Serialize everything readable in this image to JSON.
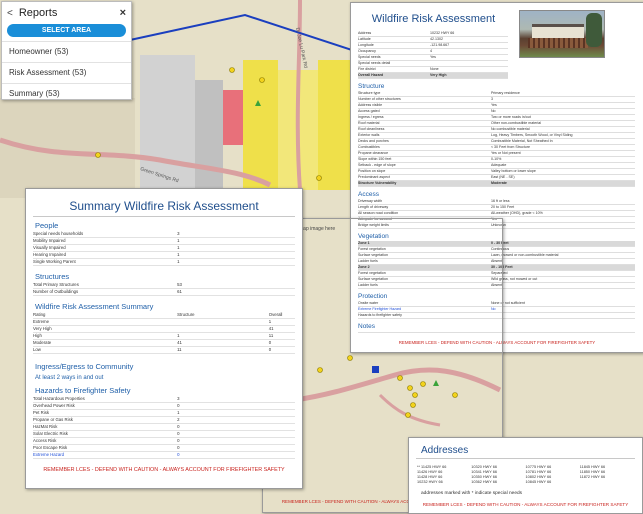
{
  "map": {
    "road_label": "Dr Joe Lu Park Rd",
    "street_label": "Green Springs Rd",
    "missing_image_text": "map image here"
  },
  "reports_panel": {
    "title": "Reports",
    "close_glyph": "×",
    "back_glyph": "<",
    "select_area_label": "SELECT AREA",
    "items": [
      "Homeowner (53)",
      "Risk Assessment (53)",
      "Summary (53)"
    ]
  },
  "risk_assessment": {
    "title": "Wildfire Risk Assessment",
    "header_rows": [
      {
        "label": "Address",
        "value": "10232 HWY 66"
      },
      {
        "label": "Latitude",
        "value": "42.1302"
      },
      {
        "label": "Longitude",
        "value": "-121.98.667"
      },
      {
        "label": "Occupancy",
        "value": "4"
      },
      {
        "label": "Special needs",
        "value": "Yes"
      },
      {
        "label": "Special needs detail",
        "value": ""
      },
      {
        "label": "Fire district",
        "value": "None"
      },
      {
        "label": "Overall Hazard",
        "value": "Very High",
        "highlight": true
      }
    ],
    "structure_heading": "Structure",
    "structure_rows": [
      {
        "label": "Structure type",
        "value": "Primary residence"
      },
      {
        "label": "Number of other structures",
        "value": "3"
      },
      {
        "label": "Address visible",
        "value": "Yes"
      },
      {
        "label": "Access gated",
        "value": "No"
      },
      {
        "label": "Ingress / egress",
        "value": "Two or more roads in/out"
      },
      {
        "label": "Roof material",
        "value": "Other non-combustible material"
      },
      {
        "label": "Roof cleanliness",
        "value": "No combustible material"
      },
      {
        "label": "Exterior walls",
        "value": "Log, Heavy Timbers, Smooth Wood, or Vinyl Siding"
      },
      {
        "label": "Decks and porches",
        "value": "Combustible Material, Not Sheathed In"
      },
      {
        "label": "Combustibles",
        "value": "< 30 Feet from Structure"
      },
      {
        "label": "Propane clearance",
        "value": "Yes or Not present"
      },
      {
        "label": "Slope within 150 feet",
        "value": "0-10%"
      },
      {
        "label": "Setback - edge of slope",
        "value": "Adequate"
      },
      {
        "label": "Position on slope",
        "value": "Valley bottom or lower slope"
      },
      {
        "label": "Predominant aspect",
        "value": "East (NE - SE)"
      },
      {
        "label": "Structure Vulnerability",
        "value": "Moderate",
        "highlight": true
      }
    ],
    "access_heading": "Access",
    "access_rows": [
      {
        "label": "Driveway width",
        "value": "16 ft or less"
      },
      {
        "label": "Length of driveway",
        "value": "20 to 150 Feet"
      },
      {
        "label": "All season road condition",
        "value": "All-weather (OHD), grade < 10%"
      },
      {
        "label": "Adequate turnaround",
        "value": "Yes"
      },
      {
        "label": "Bridge weight limits",
        "value": "Unknown"
      }
    ],
    "vegetation_heading": "Vegetation",
    "vegetation_rows": [
      {
        "label": "Zone 1",
        "value": "0 - 30 Feet",
        "highlight": true
      },
      {
        "label": "Forest vegetation",
        "value": "Continuous"
      },
      {
        "label": "Surface vegetation",
        "value": "Lawn, mowed or non-combustible material"
      },
      {
        "label": "Ladder fuels",
        "value": "Absent"
      },
      {
        "label": "Zone 2",
        "value": "30 - 100 Feet",
        "highlight": true
      },
      {
        "label": "Forest vegetation",
        "value": "Separated"
      },
      {
        "label": "Surface vegetation",
        "value": "Wild grass, not mowed or cut"
      },
      {
        "label": "Ladder fuels",
        "value": "Absent"
      }
    ],
    "protection_heading": "Protection",
    "protection_rows": [
      {
        "label": "Onsite water",
        "value": "None or not sufficient"
      },
      {
        "label": "Extreme Firefighter Hazard",
        "value": "No",
        "blue": true
      },
      {
        "label": "Hazards to firefighter safety",
        "value": ""
      }
    ],
    "notes_heading": "Notes",
    "warning": "REMEMBER LCES - DEFEND WITH CAUTION - ALWAYS ACCOUNT FOR FIREFIGHTER SAFETY"
  },
  "summary": {
    "title": "Summary Wildfire Risk Assessment",
    "people_heading": "People",
    "people_rows": [
      {
        "label": "Special needs households",
        "value": "3"
      },
      {
        "label": "Mobility Impaired",
        "value": "1"
      },
      {
        "label": "Visually Impaired",
        "value": "1"
      },
      {
        "label": "Hearing Impaired",
        "value": "1"
      },
      {
        "label": "Single Working Parent",
        "value": "1"
      }
    ],
    "structures_heading": "Structures",
    "structures_rows": [
      {
        "label": "Total Primary Structures",
        "value": "53"
      },
      {
        "label": "Number of Outbuildings",
        "value": "61"
      }
    ],
    "wra_heading": "Wildfire Risk Assessment Summary",
    "wra_columns": [
      "Rating",
      "Structure",
      "Overall"
    ],
    "wra_rows": [
      {
        "rating": "Extreme",
        "structure": "",
        "overall": "1"
      },
      {
        "rating": "Very High",
        "structure": "",
        "overall": "41"
      },
      {
        "rating": "High",
        "structure": "1",
        "overall": "11"
      },
      {
        "rating": "Moderate",
        "structure": "41",
        "overall": "0"
      },
      {
        "rating": "Low",
        "structure": "11",
        "overall": "0"
      }
    ],
    "ingress_heading": "Ingress/Egress to Community",
    "ingress_text": "At least 2 ways in and out",
    "hazards_heading": "Hazards to Firefighter Safety",
    "hazard_rows": [
      {
        "label": "Total Hazardous Properties",
        "value": "3"
      },
      {
        "label": "Overhead Power Risk",
        "value": "0"
      },
      {
        "label": "Pet Risk",
        "value": "1"
      },
      {
        "label": "Propane or Gas Risk",
        "value": "2"
      },
      {
        "label": "HazMat Risk",
        "value": "0"
      },
      {
        "label": "Solar Electric Risk",
        "value": "0"
      },
      {
        "label": "Access Risk",
        "value": "0"
      },
      {
        "label": "Poor Escape Risk",
        "value": "0"
      },
      {
        "label": "Extreme Hazard",
        "value": "0",
        "blue": true
      }
    ],
    "warning": "REMEMBER LCES - DEFEND WITH CAUTION - ALWAYS ACCOUNT FOR FIREFIGHTER SAFETY"
  },
  "map_warning": "REMEMBER LCES - DEFEND WITH CAUTION - ALWAYS ACCOUNT FOR FIREFIGHTER SAFETY",
  "addresses": {
    "title": "Addresses",
    "columns": [
      [
        "** 11425 HWY 66",
        "11426 HWY 66",
        "11428 HWY 66",
        "10232 HWY 66"
      ],
      [
        "10320 HWY 66",
        "10341 HWY 66",
        "10350 HWY 66",
        "10362 HWY 66"
      ],
      [
        "10775 HWY 66",
        "10781 HWY 66",
        "10802 HWY 66",
        "10845 HWY 66"
      ],
      [
        "11845 HWY 66",
        "11850 HWY 66",
        "11872 HWY 66"
      ]
    ],
    "note": "addresses marked with * indicate special needs",
    "warning": "REMEMBER LCES - DEFEND WITH CAUTION - ALWAYS ACCOUNT FOR FIREFIGHTER SAFETY"
  },
  "colors": {
    "accent": "#1a8ed8",
    "title_blue": "#1f4e8c",
    "warning_red": "#c8231e",
    "parcel_yellow": "#efe04a",
    "parcel_pink": "#e8707a",
    "road_blue": "#1b3fbf"
  }
}
